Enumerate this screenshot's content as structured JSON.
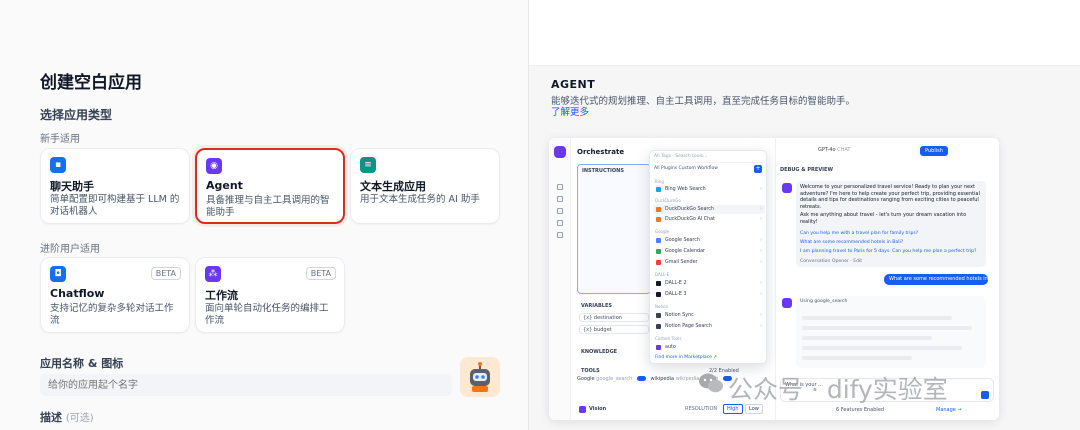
{
  "left": {
    "page_title": "创建空白应用",
    "section_title": "选择应用类型",
    "beginner_label": "新手适用",
    "advanced_label": "进阶用户适用",
    "cards": [
      {
        "title": "聊天助手",
        "desc": "简单配置即可构建基于 LLM 的对话机器人",
        "icon": "chat-bubble-icon",
        "color": "#1570ef"
      },
      {
        "title": "Agent",
        "desc": "具备推理与自主工具调用的智能助手",
        "icon": "agent-icon",
        "color": "#6938ef"
      },
      {
        "title": "文本生成应用",
        "desc": "用于文本生成任务的 AI 助手",
        "icon": "text-generator-icon",
        "color": "#0e9384"
      },
      {
        "title": "Chatflow",
        "desc": "支持记忆的复杂多轮对话工作流",
        "icon": "chatflow-icon",
        "color": "#1570ef",
        "badge": "BETA"
      },
      {
        "title": "工作流",
        "desc": "面向单轮自动化任务的编排工作流",
        "icon": "workflow-icon",
        "color": "#6938ef",
        "badge": "BETA"
      }
    ],
    "name_label": "应用名称 & 图标",
    "name_placeholder": "给你的应用起个名字",
    "desc_label": "描述",
    "desc_optional": "(可选)"
  },
  "right": {
    "agent_title": "AGENT",
    "agent_desc": "能够迭代式的规划推理、自主工具调用，直至完成任务目标的智能助手。",
    "learn_more": "了解更多",
    "preview": {
      "orchestrate": "Orchestrate",
      "instructions": "INSTRUCTIONS",
      "variables": "VARIABLES",
      "var_destination": "{x} destination",
      "var_budget": "{x} budget",
      "knowledge": "KNOWLEDGE",
      "tools": "TOOLS",
      "tools_enabled": "2/2 Enabled",
      "tool_google": "Google",
      "tool_google_sub": "google_search",
      "tool_wikipedia": "wikipedia",
      "tool_wikipedia_sub": "wikipedia_search",
      "vision": "Vision",
      "resolution": "RESOLUTION",
      "res_high": "High",
      "res_low": "Low",
      "dropdown": {
        "filter": "All Tags",
        "search": "Search tools...",
        "tabs": "All   Plugins   Custom   Workflow",
        "groups": [
          {
            "name": "Bing",
            "items": [
              "Bing Web Search"
            ]
          },
          {
            "name": "DuckDuckGo",
            "items": [
              "DuckDuckGo Search",
              "DuckDuckGo AI Chat"
            ]
          },
          {
            "name": "Google",
            "items": [
              "Google Search",
              "Google Calendar",
              "Gmail Sender"
            ]
          },
          {
            "name": "DALL-E",
            "items": [
              "DALL-E 2",
              "DALL-E 3"
            ]
          },
          {
            "name": "Notion",
            "items": [
              "Notion Sync",
              "Notion Page Search"
            ]
          },
          {
            "name": "Custom Tools",
            "items": [
              "auto"
            ]
          }
        ],
        "find_more": "Find more in Marketplace ↗"
      },
      "model": "GPT-4o",
      "model_tag": "CHAT",
      "publish": "Publish",
      "debug": "DEBUG & PREVIEW",
      "bot_msg": "Welcome to your personalized travel service! Ready to plan your next adventure? I'm here to help create your perfect trip, providing essential details and tips for destinations ranging from exciting cities to peaceful retreats.",
      "bot_ask": "Ask me anything about travel - let's turn your dream vacation into reality!",
      "suggestions": [
        "Can you help me with a travel plan for family trips?",
        "What are some recommended hotels in Bali?",
        "I am planning travel to Paris for 5 days. Can you help me plan a perfect trip?"
      ],
      "opener": "Conversation Opener · Edit",
      "user_msg": "What are some recommended hotels in Bali?",
      "using": "Using  google_search",
      "talk": "What is your ...",
      "features": "6 Features Enabled",
      "manage": "Manage →"
    }
  },
  "watermark": "公众号 · dify实验室"
}
